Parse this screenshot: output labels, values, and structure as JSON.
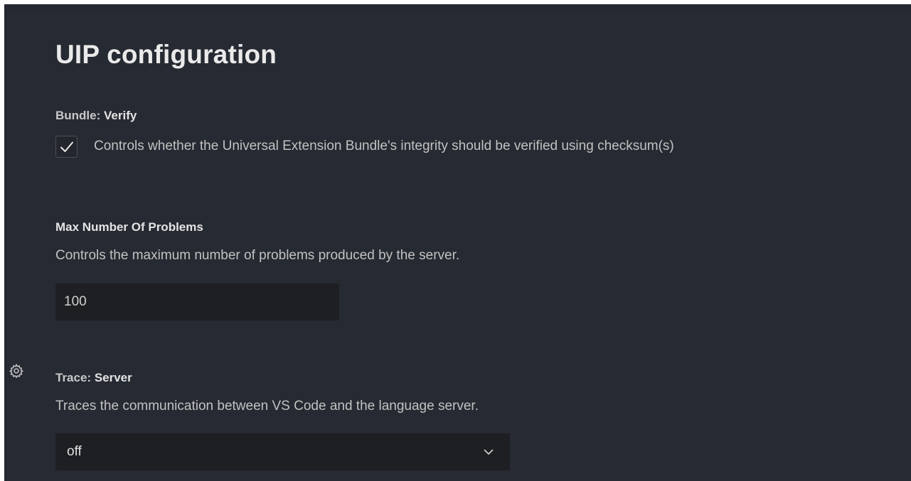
{
  "page": {
    "title": "UIP configuration"
  },
  "settings": {
    "bundle_verify": {
      "category": "Bundle: ",
      "name": "Verify",
      "description": "Controls whether the Universal Extension Bundle's integrity should be verified using checksum(s)",
      "checked": true
    },
    "max_problems": {
      "name": "Max Number Of Problems",
      "description": "Controls the maximum number of problems produced by the server.",
      "value": "100"
    },
    "trace_server": {
      "category": "Trace: ",
      "name": "Server",
      "description": "Traces the communication between VS Code and the language server.",
      "selected": "off"
    }
  },
  "icons": {
    "checkbox": "check-icon",
    "gear": "gear-icon",
    "dropdown": "chevron-down-icon"
  },
  "colors": {
    "background": "#262a32",
    "input_background": "#1e1f23",
    "text": "#c2c2c2",
    "heading": "#eaeaea"
  }
}
